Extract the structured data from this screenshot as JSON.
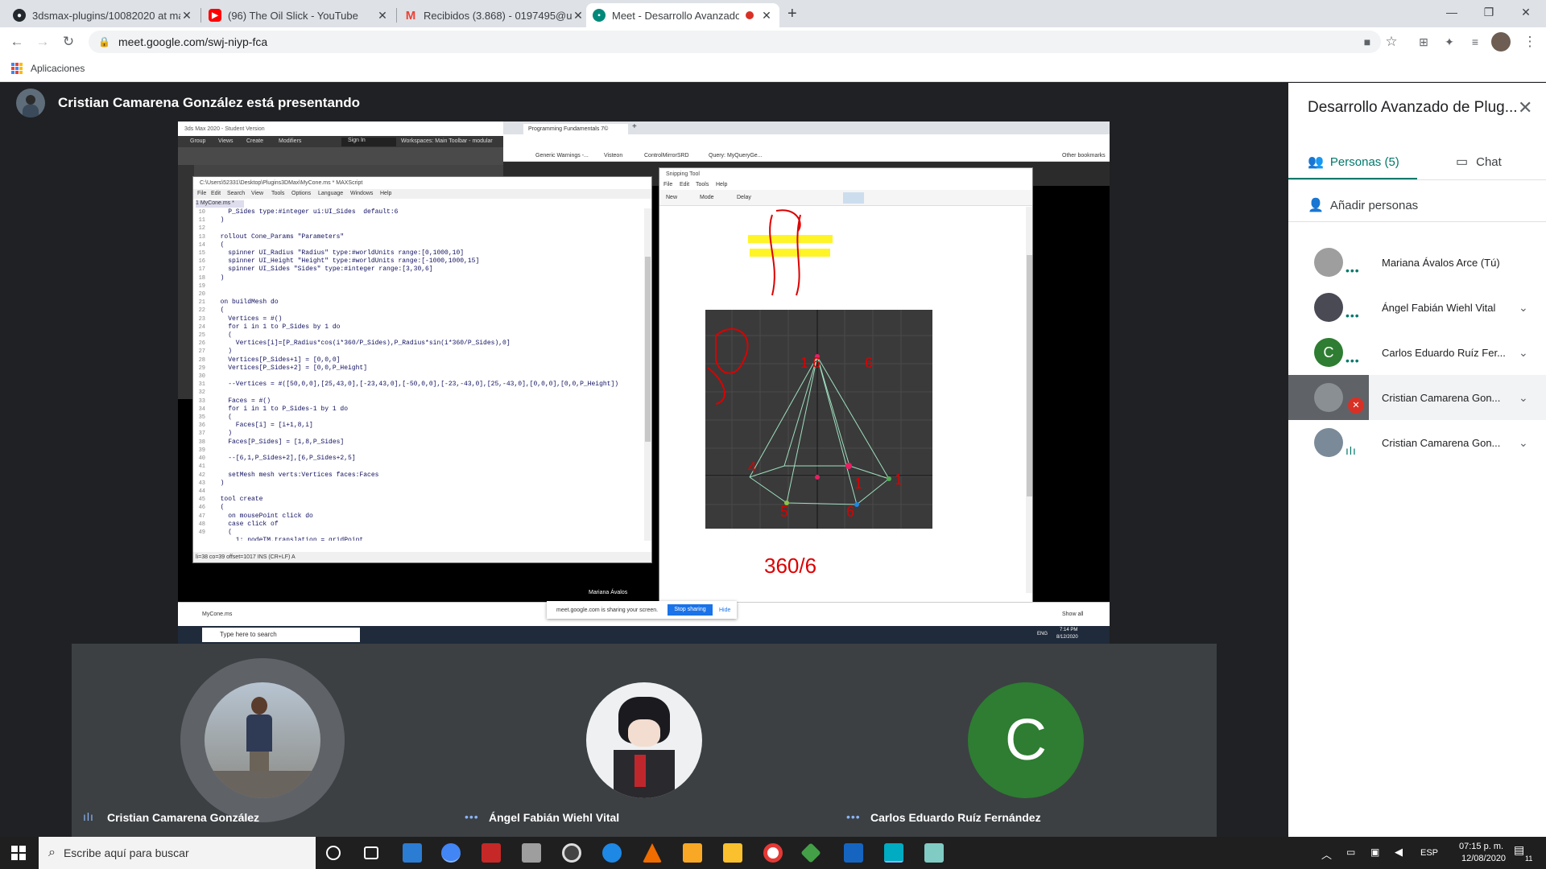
{
  "browser": {
    "tabs": [
      {
        "title": "3dsmax-plugins/10082020 at ma",
        "icon": "github-icon"
      },
      {
        "title": "(96) The Oil Slick - YouTube",
        "icon": "youtube-icon"
      },
      {
        "title": "Recibidos (3.868) - 0197495@up",
        "icon": "gmail-icon"
      },
      {
        "title": "Meet - Desarrollo Avanzado",
        "icon": "meet-icon"
      }
    ],
    "new_tab": "+",
    "url": "meet.google.com/swj-niyp-fca",
    "bookmark_apps": "Aplicaciones"
  },
  "meet": {
    "presenting_banner": "Cristian Camarena González está presentando",
    "panel": {
      "title": "Desarrollo Avanzado de Plug...",
      "tab_people": "Personas (5)",
      "tab_chat": "Chat",
      "add_people": "Añadir personas",
      "participants": [
        {
          "name": "Mariana Ávalos Arce (Tú)",
          "avatar": "photo",
          "muted": false
        },
        {
          "name": "Ángel Fabián Wiehl Vital",
          "avatar": "photo",
          "muted": false
        },
        {
          "name": "Carlos Eduardo Ruíz Fer...",
          "avatar": "C",
          "avatar_color": "#2e7d32",
          "muted": false
        },
        {
          "name": "Cristian Camarena Gon...",
          "avatar": "photo",
          "muted": true
        },
        {
          "name": "Cristian Camarena Gon...",
          "avatar": "photo",
          "muted": false
        }
      ]
    },
    "tiles": [
      {
        "name": "Cristian Camarena González"
      },
      {
        "name": "Ángel Fabián Wiehl Vital"
      },
      {
        "name": "Carlos Eduardo Ruíz Fernández",
        "letter": "C"
      }
    ],
    "shared_screen": {
      "maxscript_title": "C:\\Users\\52331\\Desktop\\Plugins3DMax\\MyCone.ms * MAXScript",
      "maxscript_menu": [
        "File",
        "Edit",
        "Search",
        "View",
        "Tools",
        "Options",
        "Language",
        "Windows",
        "Help"
      ],
      "maxscript_tab": "1 MyCone.ms *",
      "maxscript_status": "li=38 co=39 offset=1017 INS (CR+LF) A",
      "max_title": "3ds Max 2020 - Student Version",
      "max_menu": [
        "Group",
        "Views",
        "Create",
        "Modifiers"
      ],
      "max_signin": "Sign In",
      "max_workspace": "Workspaces: Main Toolbar - modular",
      "snip_title": "Snipping Tool",
      "snip_menu": [
        "File",
        "Edit",
        "Tools",
        "Help"
      ],
      "snip_buttons": [
        "New",
        "Mode",
        "Delay"
      ],
      "chrome_tab": "Programming Fundamentals 7©",
      "bookmarks": [
        "Generic Warnings -...",
        "Visteon",
        "ControlMirrorSRD",
        "Query: MyQueryGe...",
        "Other bookmarks"
      ],
      "presenter_small": "Mariana Ávalos",
      "sharing_msg": "meet.google.com is sharing your screen.",
      "stop_sharing": "Stop sharing",
      "hide": "Hide",
      "download_file": "MyCone.ms",
      "show_all": "Show all",
      "inner_search": "Type here to search",
      "inner_time": "7:14 PM",
      "inner_date": "8/12/2020",
      "inner_lang": "ENG",
      "line_numbers": "10\n11\n12\n13\n14\n15\n16\n17\n18\n19\n20\n21\n22\n23\n24\n25\n26\n27\n28\n29\n30\n31\n32\n33\n34\n35\n36\n37\n38\n39\n40\n41\n42\n43\n44\n45\n46\n47\n48\n49",
      "code": "    P_Sides type:#integer ui:UI_Sides  default:6\n  )\n\n  rollout Cone_Params \"Parameters\"\n  (\n    spinner UI_Radius \"Radius\" type:#worldUnits range:[0,1000,10]\n    spinner UI_Height \"Height\" type:#worldUnits range:[-1000,1000,15]\n    spinner UI_Sides \"Sides\" type:#integer range:[3,30,6]\n  )\n\n\n  on buildMesh do\n  (\n    Vertices = #()\n    for i in 1 to P_Sides by 1 do\n    (\n      Vertices[i]=[P_Radius*cos(i*360/P_Sides),P_Radius*sin(i*360/P_Sides),0]\n    )\n    Vertices[P_Sides+1] = [0,0,0]\n    Vertices[P_Sides+2] = [0,0,P_Height]\n\n    --Vertices = #([50,0,0],[25,43,0],[-23,43,0],[-50,0,0],[-23,-43,0],[25,-43,0],[0,0,0],[0,0,P_Height])\n\n    Faces = #()\n    for i in 1 to P_Sides-1 by 1 do\n    (\n      Faces[i] = [i+1,8,i]\n    )\n    Faces[P_Sides] = [1,8,P_Sides]\n\n    --[6,1,P_Sides+2],[6,P_Sides+2,5]\n\n    setMesh mesh verts:Vertices faces:Faces\n  )\n\n  tool create\n  (\n    on mousePoint click do\n    case click of\n    (\n      1: nodeTM.translation = gridPoint"
    }
  },
  "taskbar": {
    "search_placeholder": "Escribe aquí para buscar",
    "lang": "ESP",
    "time": "07:15 p. m.",
    "date": "12/08/2020",
    "notif_count": "11"
  }
}
